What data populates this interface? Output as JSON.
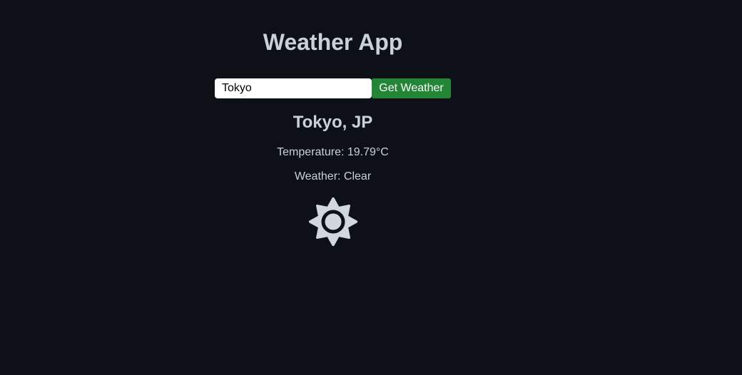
{
  "app": {
    "title": "Weather App"
  },
  "search": {
    "value": "Tokyo",
    "button_label": "Get Weather"
  },
  "result": {
    "city": "Tokyo, JP",
    "temperature_text": "Temperature: 19.79°C",
    "weather_text": "Weather: Clear",
    "icon": "sun-icon"
  },
  "colors": {
    "background": "#0d1117",
    "text": "#c9d1d9",
    "button": "#238636",
    "input_bg": "#ffffff"
  }
}
